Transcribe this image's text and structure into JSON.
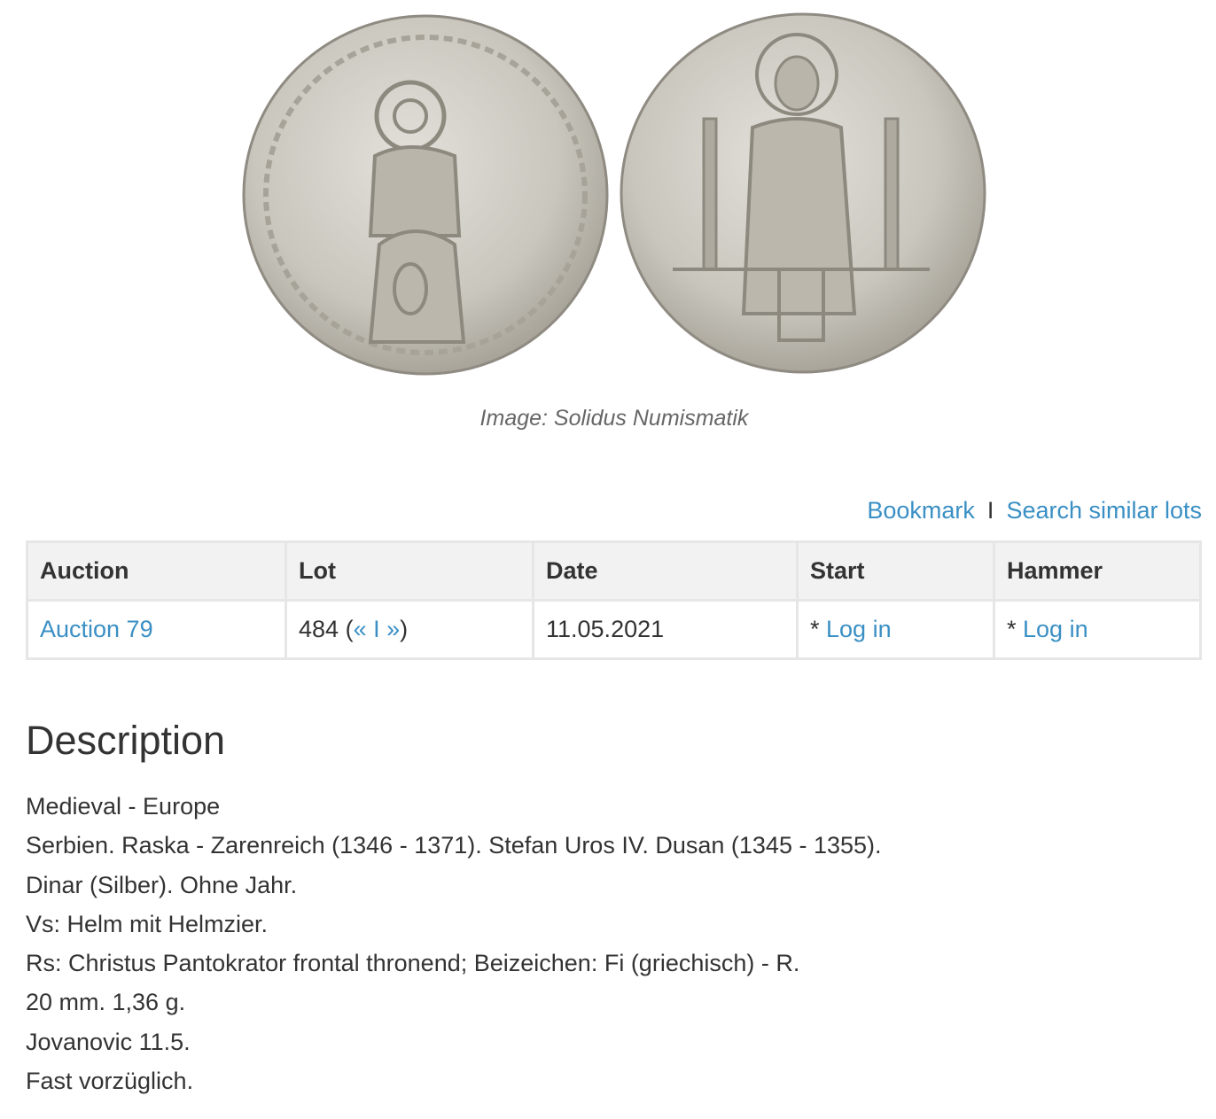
{
  "images": {
    "obverse_icon": "coin-obverse-image",
    "reverse_icon": "coin-reverse-image",
    "caption": "Image: Solidus Numismatik"
  },
  "actions": {
    "bookmark": "Bookmark",
    "separator": "I",
    "search_similar": "Search similar lots"
  },
  "table": {
    "headers": {
      "auction": "Auction",
      "lot": "Lot",
      "date": "Date",
      "start": "Start",
      "hammer": "Hammer"
    },
    "row": {
      "auction": "Auction 79",
      "lot_number": "484",
      "lot_open": " (",
      "prev": "«",
      "nav_sep": " I ",
      "next": "»",
      "lot_close": ")",
      "date": "11.05.2021",
      "start_prefix": "* ",
      "start_link": "Log in",
      "hammer_prefix": "* ",
      "hammer_link": "Log in"
    }
  },
  "description": {
    "title": "Description",
    "lines": [
      "Medieval - Europe",
      "Serbien. Raska - Zarenreich (1346 - 1371). Stefan Uros IV. Dusan (1345 - 1355).",
      "Dinar (Silber). Ohne Jahr.",
      "Vs: Helm mit Helmzier.",
      "Rs: Christus Pantokrator frontal thronend; Beizeichen: Fi (griechisch) - R.",
      "20 mm. 1,36 g.",
      "Jovanovic 11.5.",
      "Fast vorzüglich."
    ]
  },
  "colors": {
    "link": "#3a8fc4",
    "text": "#333333",
    "header_bg": "#f2f2f2",
    "border": "#e6e6e6",
    "coin_silver": "#c9c6bd"
  }
}
